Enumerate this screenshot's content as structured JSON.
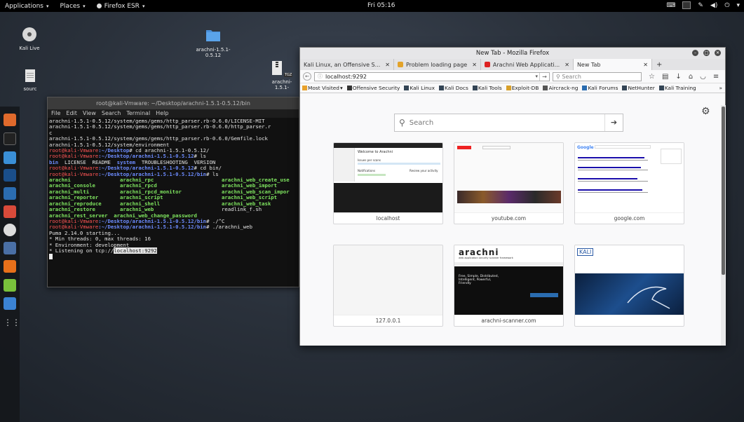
{
  "topbar": {
    "applications": "Applications",
    "places": "Places",
    "firefox": "Firefox ESR",
    "clock": "Fri 05:16",
    "caret": "▾"
  },
  "desktop": {
    "icons": [
      {
        "label": "Kali Live"
      },
      {
        "label": "arachni-1.5.1-0.5.12"
      },
      {
        "label": "arachni-1.5.1-"
      },
      {
        "label": "sourc"
      }
    ],
    "tgz_badge": "TGZ"
  },
  "terminal": {
    "title": "root@kali-Vmware: ~/Desktop/arachni-1.5.1-0.5.12/bin",
    "menu": [
      "File",
      "Edit",
      "View",
      "Search",
      "Terminal",
      "Help"
    ],
    "lines_top": [
      "arachni-1.5.1-0.5.12/system/gems/gems/http_parser.rb-0.6.0/LICENSE-MIT",
      "arachni-1.5.1-0.5.12/system/gems/gems/http_parser.rb-0.6.0/http_parser.r",
      "c",
      "arachni-1.5.1-0.5.12/system/gems/gems/http_parser.rb-0.6.0/Gemfile.lock",
      "arachni-1.5.1-0.5.12/system/environment"
    ],
    "prompt1_user": "root@kali-Vmware",
    "prompt1_path": ":~/Desktop",
    "prompt1_cmd": "# cd arachni-1.5.1-0.5.12/",
    "prompt2_user": "root@kali-Vmware",
    "prompt2_path": ":~/Desktop/arachni-1.5.1-0.5.12",
    "prompt2_cmd": "# ls",
    "ls1_bin": "bin",
    "ls1_rest": "  LICENSE  README  ",
    "ls1_system": "system",
    "ls1_tail": "  TROUBLESHOOTING  VERSION",
    "prompt3_user": "root@kali-Vmware",
    "prompt3_path": ":~/Desktop/arachni-1.5.1-0.5.12",
    "prompt3_cmd": "# cd bin/",
    "prompt4_user": "root@kali-Vmware",
    "prompt4_path": ":~/Desktop/arachni-1.5.1-0.5.12/bin",
    "prompt4_cmd": "# ls",
    "ls_rows": [
      [
        "arachni",
        "arachni_rpc",
        "arachni_web_create_use"
      ],
      [
        "arachni_console",
        "arachni_rpcd",
        "arachni_web_import"
      ],
      [
        "arachni_multi",
        "arachni_rpcd_monitor",
        "arachni_web_scan_impor"
      ],
      [
        "arachni_reporter",
        "arachni_script",
        "arachni_web_script"
      ],
      [
        "arachni_reproduce",
        "arachni_shell",
        "arachni_web_task"
      ],
      [
        "arachni_restore",
        "arachni_web",
        "readlink_f.sh"
      ]
    ],
    "ls_last": "arachni_rest_server  arachni_web_change_password",
    "prompt5_user": "root@kali-Vmware",
    "prompt5_path": ":~/Desktop/arachni-1.5.1-0.5.12/bin",
    "prompt5_cmd": "# ./^C",
    "prompt6_user": "root@kali-Vmware",
    "prompt6_path": ":~/Desktop/arachni-1.5.1-0.5.12/bin",
    "prompt6_cmd": "# ./arachni_web",
    "out": [
      "Puma 2.14.0 starting...",
      "* Min threads: 0, max threads: 16",
      "* Environment: development"
    ],
    "listen_prefix": "* Listening on tcp://",
    "listen_addr": "localhost:9292"
  },
  "firefox": {
    "title": "New Tab - Mozilla Firefox",
    "tabs": [
      {
        "label": "Kali Linux, an Offensive S..."
      },
      {
        "label": "Problem loading page"
      },
      {
        "label": "Arachni Web Applicati..."
      },
      {
        "label": "New Tab"
      }
    ],
    "new_tab": "+",
    "url": "localhost:9292",
    "search_placeholder": "Search",
    "bookmarks": [
      "Most Visited",
      "Offensive Security",
      "Kali Linux",
      "Kali Docs",
      "Kali Tools",
      "Exploit-DB",
      "Aircrack-ng",
      "Kali Forums",
      "NetHunter",
      "Kali Training"
    ],
    "bookmarks_more": "»",
    "page_search_placeholder": "Search",
    "tiles": [
      {
        "label": "localhost"
      },
      {
        "label": "youtube.com"
      },
      {
        "label": "google.com"
      },
      {
        "label": "127.0.0.1"
      },
      {
        "label": "arachni-scanner.com"
      },
      {
        "label": ""
      }
    ],
    "tile_texts": {
      "localhost_heading": "Welcome to Arachni",
      "localhost_issues": "Issues per scans",
      "localhost_notifications": "Notifications",
      "localhost_activity": "Review your activity",
      "google_logo": "Google",
      "arachni_logo": "arachni",
      "arachni_tagline": "web application security scanner framework",
      "arachni_headline": "Free, Simple, Distributed, Intelligent, Powerful, Friendly",
      "kali_logo": "KALI"
    }
  }
}
